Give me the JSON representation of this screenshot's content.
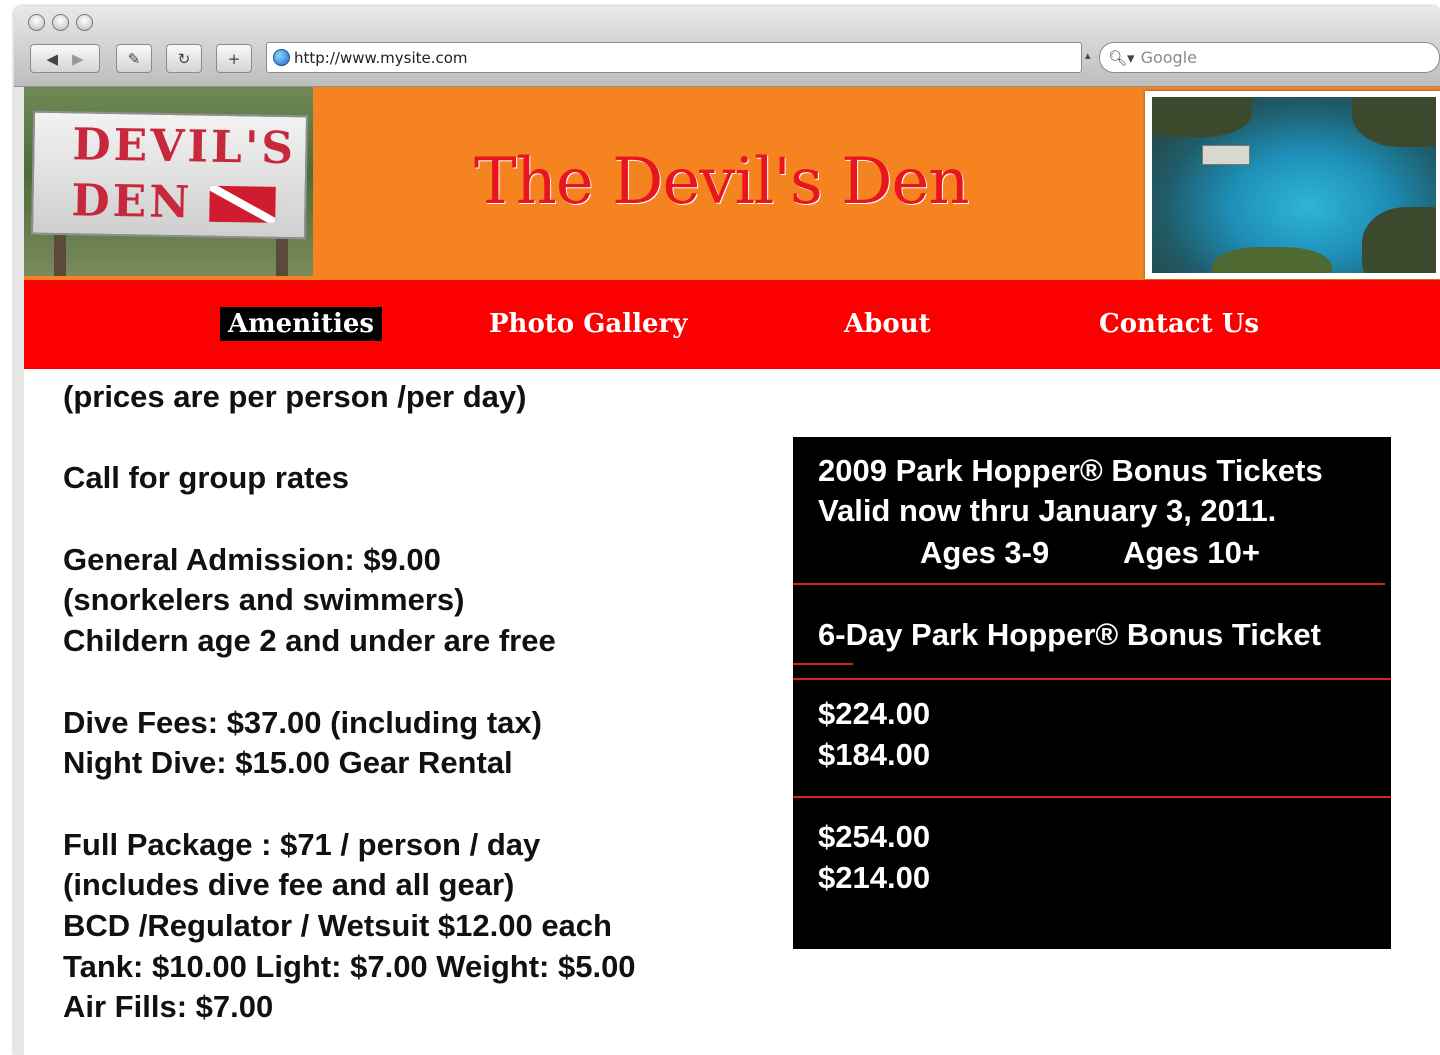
{
  "browser": {
    "url": "http://www.mysite.com",
    "search_placeholder": "Google"
  },
  "site": {
    "title": "The Devil's Den",
    "logo_text_line1": "DEVIL'S",
    "logo_text_line2": "DEN"
  },
  "nav": {
    "items": [
      {
        "label": "Amenities",
        "active": true
      },
      {
        "label": "Photo Gallery",
        "active": false
      },
      {
        "label": "About",
        "active": false
      },
      {
        "label": "Contact Us",
        "active": false
      }
    ]
  },
  "pricing": {
    "lines": [
      "(prices are per person /per day)",
      "",
      "Call for group rates",
      "",
      "General Admission: $9.00",
      "(snorkelers and swimmers)",
      "Childern age 2 and under are free",
      "",
      "Dive Fees: $37.00 (including tax)",
      "Night Dive: $15.00 Gear Rental",
      "",
      "Full Package : $71 / person / day",
      "(includes dive fee and all gear)",
      "BCD /Regulator / Wetsuit $12.00 each",
      "Tank: $10.00 Light: $7.00 Weight: $5.00",
      "Air Fills: $7.00"
    ]
  },
  "tickets": {
    "heading_line1": "2009 Park Hopper® Bonus Tickets",
    "heading_line2": "Valid now thru January 3, 2011.",
    "age_col1": "Ages 3-9",
    "age_col2": "Ages 10+",
    "ticket_name": "6-Day Park Hopper® Bonus Ticket",
    "price_a1": "$224.00",
    "price_a2": "$184.00",
    "price_b1": "$254.00",
    "price_b2": "$214.00"
  },
  "colors": {
    "header_bg": "#f58420",
    "nav_bg": "#fb0000",
    "title_red": "#e8141e",
    "ticket_bg": "#000000"
  }
}
